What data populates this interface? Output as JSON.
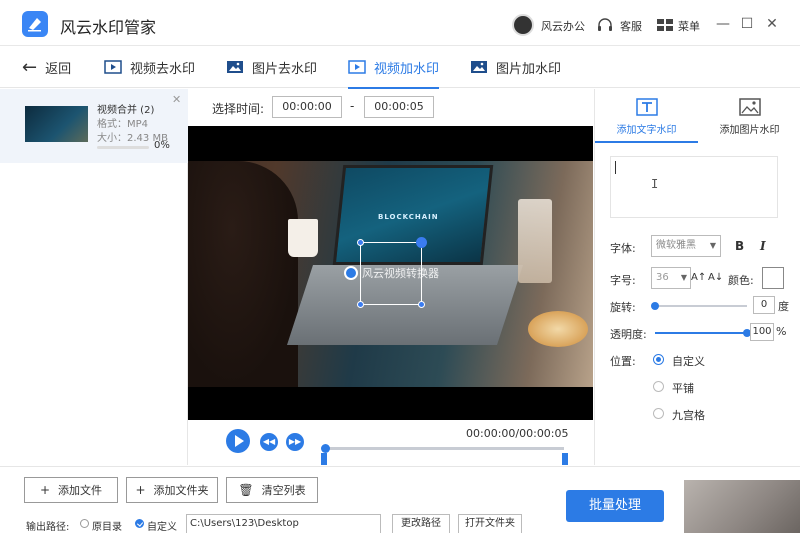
{
  "app": {
    "title": "风云水印管家"
  },
  "header": {
    "user_name": "风云办公",
    "kefu_label": "客服",
    "menu_label": "菜单",
    "min_icon": "minimize-icon",
    "max_icon": "maximize-icon",
    "close_icon": "close-icon"
  },
  "nav": {
    "back_label": "返回",
    "tabs": [
      {
        "label": "视频去水印",
        "icon": "video-icon"
      },
      {
        "label": "图片去水印",
        "icon": "image-icon"
      },
      {
        "label": "视频加水印",
        "icon": "video-icon",
        "active": true
      },
      {
        "label": "图片加水印",
        "icon": "image-icon"
      }
    ]
  },
  "files": [
    {
      "name": "视频合并 (2)",
      "format": "格式：MP4",
      "size": "大小：2.43 MB",
      "progress": 0,
      "progress_label": "0%"
    }
  ],
  "time_select": {
    "label": "选择时间:",
    "start": "00:00:00",
    "dash": "-",
    "end": "00:00:05"
  },
  "video": {
    "screen_text": "BLOCKCHAIN",
    "watermark_text": "风云视频转换器",
    "time_display": "00:00:00/00:00:05",
    "timeline_position": 0
  },
  "right_panel": {
    "tabs": [
      {
        "label": "添加文字水印",
        "icon": "text-watermark-icon",
        "active": true
      },
      {
        "label": "添加图片水印",
        "icon": "image-watermark-icon"
      }
    ],
    "text_value": "",
    "font_label": "字体:",
    "font_value": "微软雅黑",
    "bold": "B",
    "italic": "I",
    "size_label": "字号:",
    "size_value": "36",
    "increase_font": "A↑",
    "decrease_font": "A↓",
    "color_label": "颜色:",
    "rotate_label": "旋转:",
    "rotate_value": "0",
    "rotate_unit": "度",
    "rotate_fraction": 0,
    "opacity_label": "透明度:",
    "opacity_value": "100",
    "opacity_unit": "%",
    "opacity_fraction": 1,
    "position_label": "位置:",
    "position_options": [
      "自定义",
      "平铺",
      "九宫格"
    ],
    "position_selected": "自定义"
  },
  "bottom": {
    "add_file": "添加文件",
    "add_folder": "添加文件夹",
    "clear_list": "清空列表",
    "output_label": "输出路径:",
    "opt_original": "原目录",
    "opt_custom": "自定义",
    "path_value": "C:\\Users\\123\\Desktop",
    "change_path": "更改路径",
    "open_folder": "打开文件夹",
    "batch": "批量处理"
  },
  "colors": {
    "accent": "#2c7be5"
  }
}
